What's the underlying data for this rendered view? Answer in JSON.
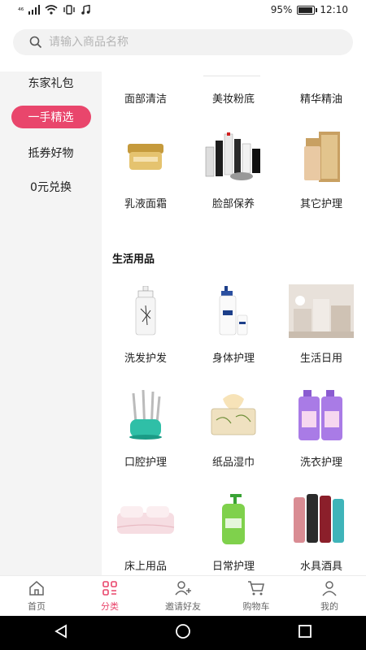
{
  "status_bar": {
    "network": "⁴⁶",
    "battery_percent": "95%",
    "battery_level": 0.95,
    "time": "12:10"
  },
  "search": {
    "placeholder": "请输入商品名称"
  },
  "sidebar": {
    "items": [
      {
        "label": "东家礼包",
        "active": false
      },
      {
        "label": "一手精选",
        "active": true
      },
      {
        "label": "抵券好物",
        "active": false
      },
      {
        "label": "0元兑换",
        "active": false
      }
    ]
  },
  "categories": {
    "row1": [
      "面部清洁",
      "美妆粉底",
      "精华精油"
    ],
    "row2": [
      "乳液面霜",
      "脸部保养",
      "其它护理"
    ],
    "section_title": "生活用品",
    "row3": [
      "洗发护发",
      "身体护理",
      "生活日用"
    ],
    "row4": [
      "口腔护理",
      "纸品湿巾",
      "洗衣护理"
    ],
    "row5": [
      "床上用品",
      "日常护理",
      "水具酒具"
    ]
  },
  "bottom_nav": {
    "items": [
      {
        "label": "首页",
        "icon": "home-icon",
        "active": false
      },
      {
        "label": "分类",
        "icon": "category-icon",
        "active": true
      },
      {
        "label": "邀请好友",
        "icon": "invite-friend-icon",
        "active": false
      },
      {
        "label": "购物车",
        "icon": "cart-icon",
        "active": false
      },
      {
        "label": "我的",
        "icon": "profile-icon",
        "active": false
      }
    ]
  },
  "colors": {
    "accent": "#e9466c",
    "sidebar_bg": "#f4f4f4",
    "search_bg": "#f2f2f2"
  }
}
